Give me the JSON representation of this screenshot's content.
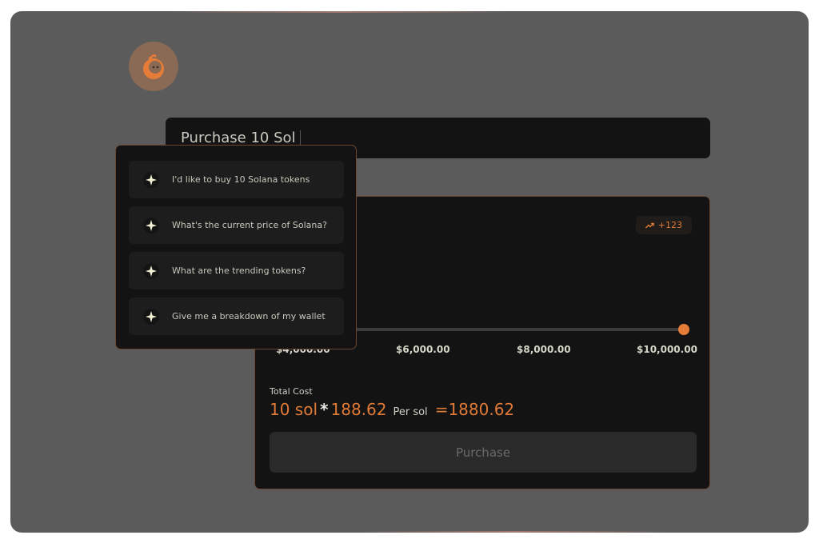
{
  "logo": {
    "icon": "orange-mascot-icon",
    "color": "#e57c37"
  },
  "prompt_input": {
    "value": "Purchase 10 Sol"
  },
  "card": {
    "change_badge": {
      "icon": "trend-up-icon",
      "value": "+123"
    },
    "price_fragment": "62",
    "slider_label_fragment": "rchase",
    "slider": {
      "value_fraction": 1.0,
      "ticks": [
        "$4,000.00",
        "$6,000.00",
        "$8,000.00",
        "$10,000.00"
      ]
    },
    "total_cost": {
      "label": "Total Cost",
      "quantity": "10 sol",
      "operator": "*",
      "unit_price": "188.62",
      "unit_label": "Per sol",
      "result": "=1880.62"
    },
    "purchase_button": "Purchase"
  },
  "suggestions": [
    {
      "icon": "sparkle-icon",
      "label": "I'd like to buy 10 Solana tokens"
    },
    {
      "icon": "sparkle-icon",
      "label": "What's the current price of Solana?"
    },
    {
      "icon": "sparkle-icon",
      "label": "What are the trending tokens?"
    },
    {
      "icon": "sparkle-icon",
      "label": "Give me a breakdown of my wallet"
    }
  ],
  "colors": {
    "accent": "#e07a36",
    "overlay": "#5b5b5b",
    "panel": "#131313",
    "border": "#6a4732"
  }
}
